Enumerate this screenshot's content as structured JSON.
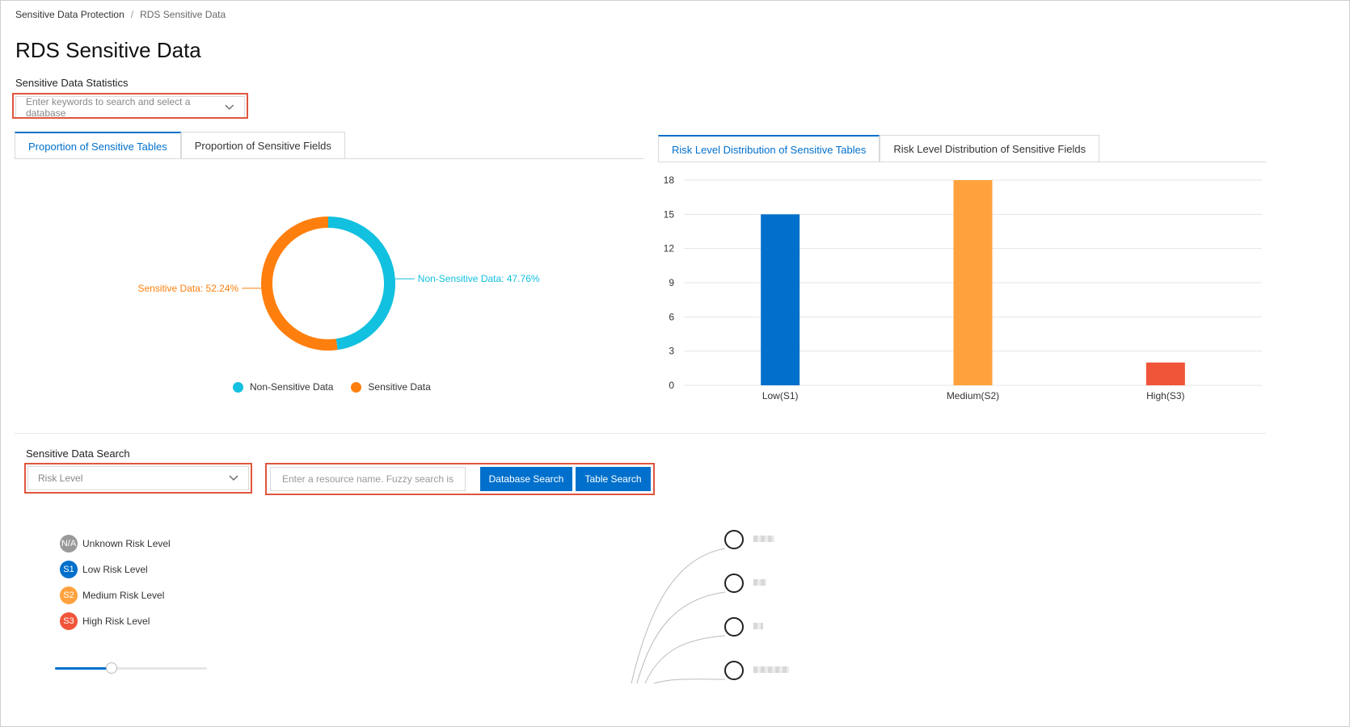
{
  "breadcrumb": {
    "root": "Sensitive Data Protection",
    "separator": "/",
    "current": "RDS Sensitive Data"
  },
  "title": "RDS Sensitive Data",
  "statistics": {
    "label": "Sensitive Data Statistics",
    "db_select_placeholder": "Enter keywords to search and select a database",
    "left_tabs": [
      "Proportion of Sensitive Tables",
      "Proportion of Sensitive Fields"
    ],
    "right_tabs": [
      "Risk Level Distribution of Sensitive Tables",
      "Risk Level Distribution of Sensitive Fields"
    ]
  },
  "colors": {
    "accent": "#0070cc",
    "non_sensitive": "#12c0e0",
    "sensitive": "#ff7f0e",
    "low": "#0070cc",
    "medium": "#ffa23d",
    "high": "#f0553a",
    "unknown": "#999999",
    "highlight": "#e0553e"
  },
  "chart_data": [
    {
      "type": "pie",
      "labels": [
        "Non-Sensitive Data",
        "Sensitive Data"
      ],
      "values": [
        47.76,
        52.24
      ],
      "slice_labels": [
        "Non-Sensitive Data: 47.76%",
        "Sensitive Data: 52.24%"
      ],
      "legend": [
        "Non-Sensitive Data",
        "Sensitive Data"
      ],
      "legend_position": "bottom"
    },
    {
      "type": "bar",
      "categories": [
        "Low(S1)",
        "Medium(S2)",
        "High(S3)"
      ],
      "values": [
        15,
        18,
        2
      ],
      "yticks": [
        "0",
        "3",
        "6",
        "9",
        "12",
        "15",
        "18"
      ],
      "ylim": [
        0,
        18
      ],
      "grid": true
    }
  ],
  "search": {
    "label": "Sensitive Data Search",
    "risk_select": "Risk Level",
    "resource_placeholder": "Enter a resource name. Fuzzy search is supported.",
    "db_button": "Database Search",
    "table_button": "Table Search"
  },
  "risk_legend": [
    {
      "code": "N/A",
      "label": "Unknown Risk Level"
    },
    {
      "code": "S1",
      "label": "Low Risk Level"
    },
    {
      "code": "S2",
      "label": "Medium Risk Level"
    },
    {
      "code": "S3",
      "label": "High Risk Level"
    }
  ],
  "zoom_slider": {
    "level": 0.37
  }
}
